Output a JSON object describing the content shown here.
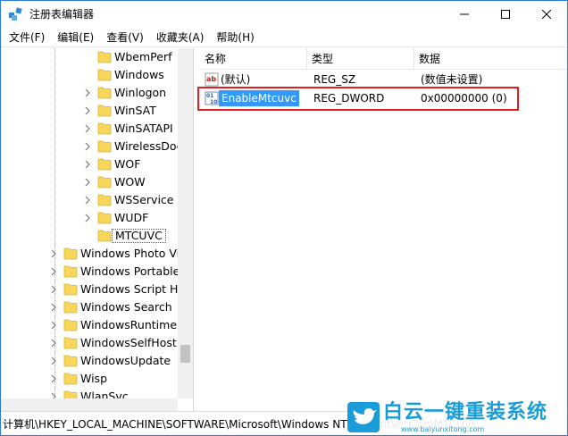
{
  "window": {
    "title": "注册表编辑器"
  },
  "menu": [
    "文件(F)",
    "编辑(E)",
    "查看(V)",
    "收藏夹(A)",
    "帮助(H)"
  ],
  "tree": {
    "items": [
      {
        "label": "WbemPerf",
        "expandable": false,
        "selected": false
      },
      {
        "label": "Windows",
        "expandable": false,
        "selected": false
      },
      {
        "label": "Winlogon",
        "expandable": true,
        "selected": false
      },
      {
        "label": "WinSAT",
        "expandable": true,
        "selected": false
      },
      {
        "label": "WinSATAPI",
        "expandable": true,
        "selected": false
      },
      {
        "label": "WirelessDocking",
        "expandable": true,
        "selected": false
      },
      {
        "label": "WOF",
        "expandable": true,
        "selected": false
      },
      {
        "label": "WOW",
        "expandable": true,
        "selected": false
      },
      {
        "label": "WSService",
        "expandable": true,
        "selected": false
      },
      {
        "label": "WUDF",
        "expandable": true,
        "selected": false
      },
      {
        "label": "MTCUVC",
        "expandable": false,
        "selected": true
      }
    ],
    "parent_items": [
      {
        "label": "Windows Photo Viewer",
        "expandable": true
      },
      {
        "label": "Windows Portable Devices",
        "expandable": true
      },
      {
        "label": "Windows Script Host",
        "expandable": true
      },
      {
        "label": "Windows Search",
        "expandable": true
      },
      {
        "label": "WindowsRuntime",
        "expandable": true
      },
      {
        "label": "WindowsSelfHost",
        "expandable": true
      },
      {
        "label": "WindowsUpdate",
        "expandable": true
      },
      {
        "label": "Wisp",
        "expandable": true
      },
      {
        "label": "WlanSvc",
        "expandable": true
      }
    ]
  },
  "list": {
    "columns": [
      "名称",
      "类型",
      "数据"
    ],
    "rows": [
      {
        "icon": "string-value-icon",
        "name": "(默认)",
        "type": "REG_SZ",
        "data": "(数值未设置)",
        "selected": false
      },
      {
        "icon": "dword-value-icon",
        "name": "EnableMtcuvc",
        "type": "REG_DWORD",
        "data": "0x00000000 (0)",
        "selected": true
      }
    ]
  },
  "status": {
    "path": "计算机\\HKEY_LOCAL_MACHINE\\SOFTWARE\\Microsoft\\Windows NT\\CurrentVersion\\MTCUVC"
  },
  "watermark": {
    "text": "白云一键重装系统",
    "sub": "www.baiyunxitong.com"
  },
  "colors": {
    "selection": "#3399ff",
    "highlight_border": "#e02020",
    "folder": "#f8d65a",
    "watermark": "#1a9cd8"
  }
}
